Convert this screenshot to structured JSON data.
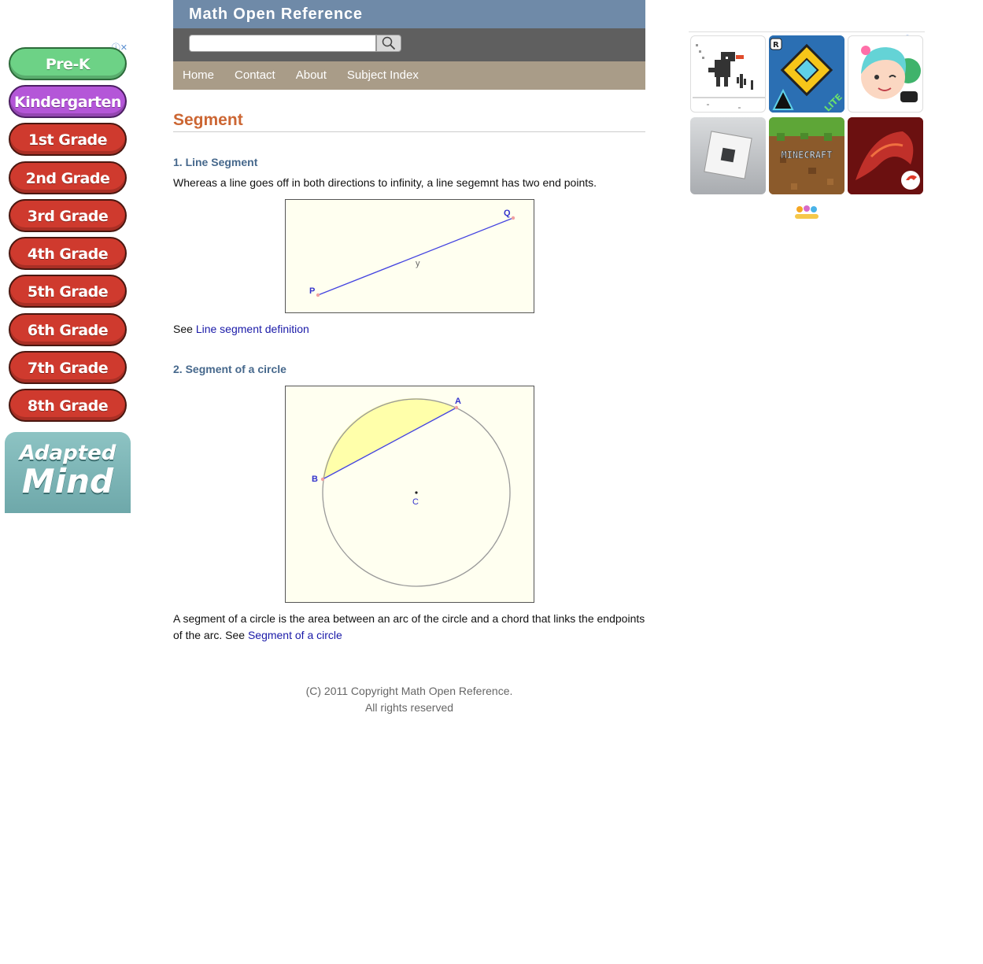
{
  "left_ad": {
    "badge": "ⓘ✕",
    "grades": [
      "Pre-K",
      "Kindergarten",
      "1st Grade",
      "2nd Grade",
      "3rd Grade",
      "4th Grade",
      "5th Grade",
      "6th Grade",
      "7th Grade",
      "8th Grade"
    ],
    "brand_line1": "Adapted",
    "brand_line2": "Mind"
  },
  "header": {
    "site_title": "Math Open Reference",
    "search_placeholder": "",
    "search_icon": "magnifier-icon"
  },
  "nav": [
    "Home",
    "Contact",
    "About",
    "Subject Index"
  ],
  "content": {
    "page_title": "Segment",
    "section1": {
      "heading": "1. Line Segment",
      "text": "Whereas a line goes off in both directions to infinity, a line segemnt has two end points.",
      "figure": {
        "label_p": "P",
        "label_q": "Q",
        "label_mid": "y"
      },
      "see_prefix": "See ",
      "see_link": "Line segment definition"
    },
    "section2": {
      "heading": "2. Segment of a circle",
      "figure": {
        "label_a": "A",
        "label_b": "B",
        "label_c": "C"
      },
      "text_before": "A segment of a circle is the area between an arc of the circle and a chord that links the endpoints of the arc. See ",
      "link": "Segment of a circle"
    }
  },
  "footer": {
    "line1": "(C) 2011 Copyright Math Open Reference.",
    "line2": "All rights reserved"
  },
  "right_ad": {
    "badge": "ⓘ✕",
    "games": [
      "dino-game",
      "geometry-dash-lite",
      "toca-world",
      "roblox",
      "minecraft",
      "free-fire"
    ],
    "minecraft_text": "MINECRAFT",
    "lite_text": "LITE"
  },
  "colors": {
    "header_blue": "#6f8aa8",
    "search_gray": "#5f5f5f",
    "nav_tan": "#a99c88",
    "title_orange": "#cc6633",
    "section_blue": "#46688c",
    "link_blue": "#1a1aa8"
  }
}
